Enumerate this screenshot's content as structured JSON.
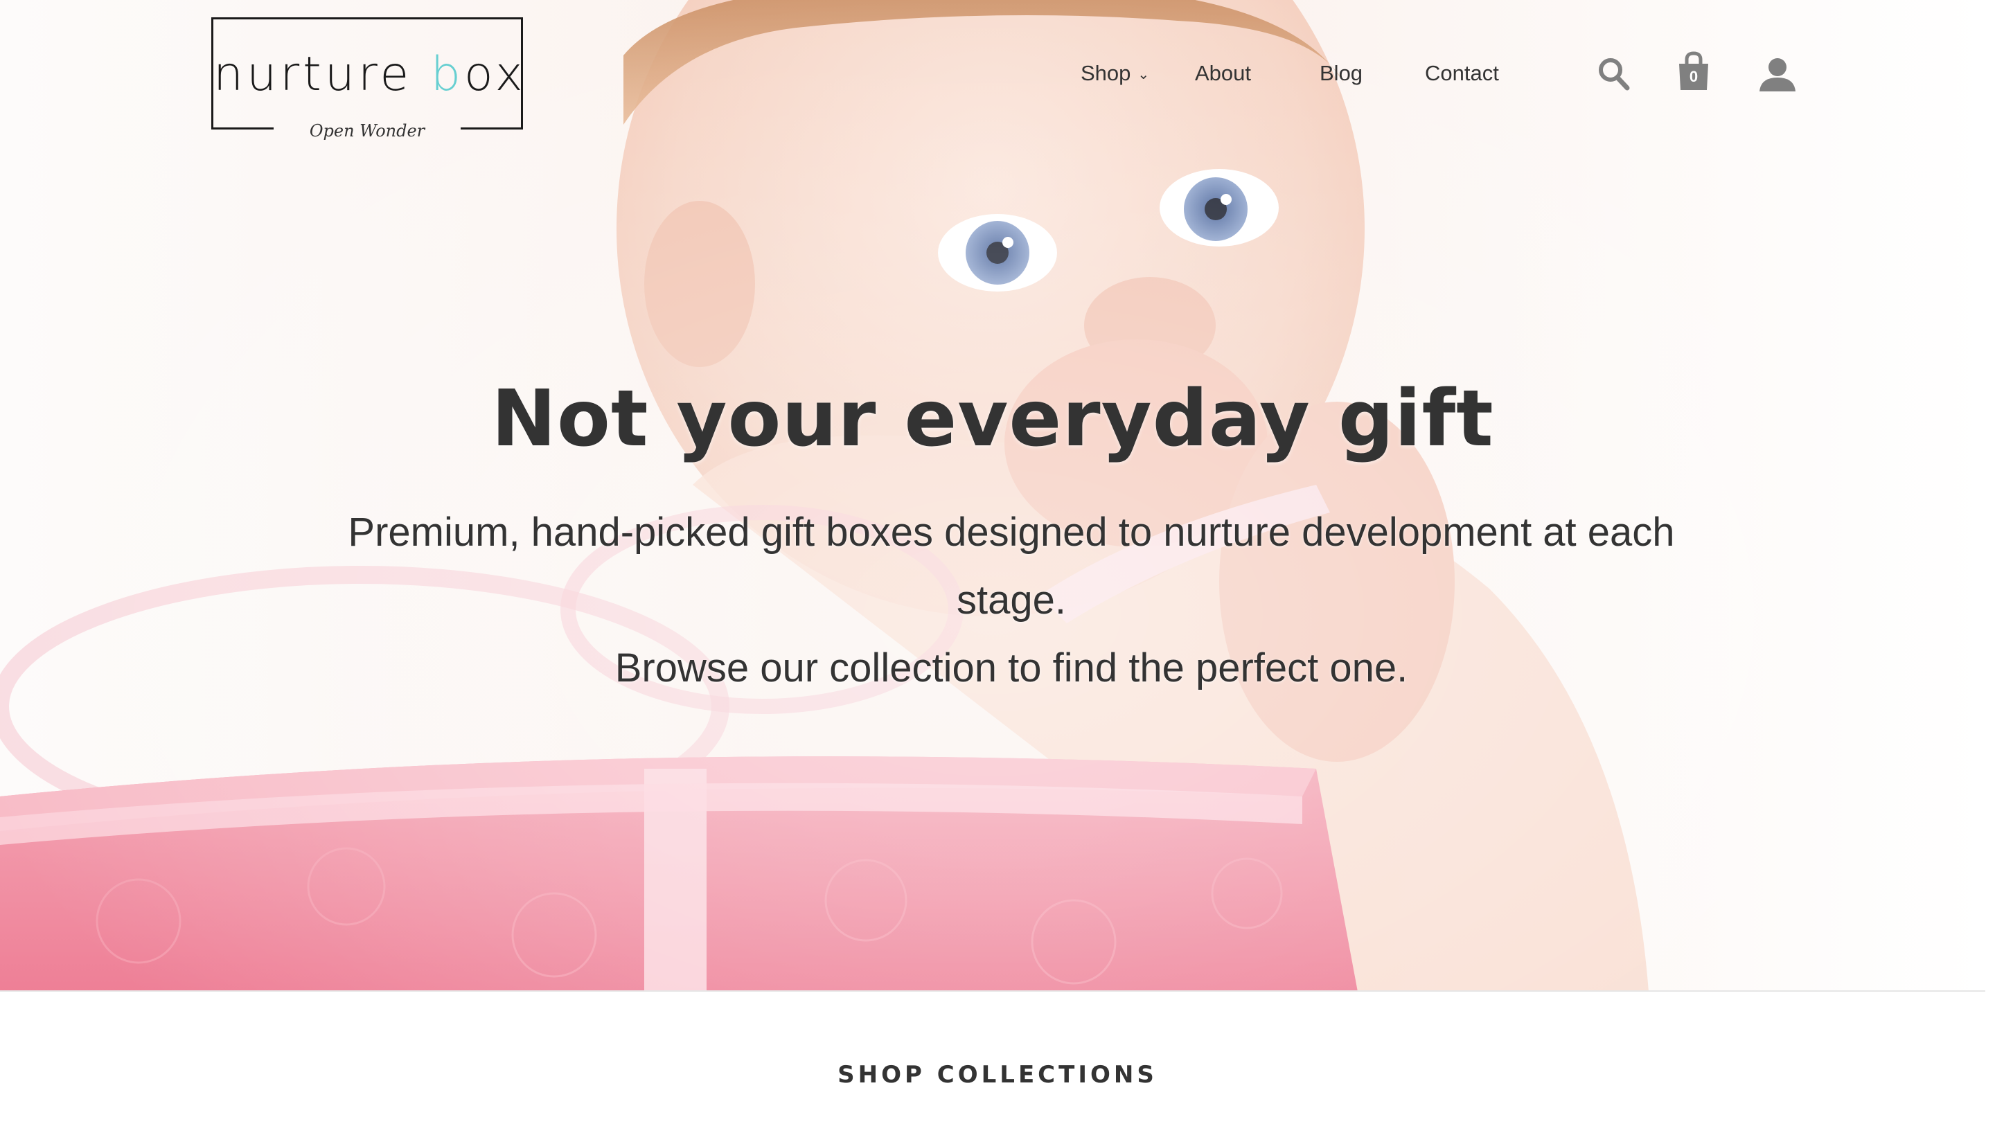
{
  "brand": {
    "wordmark_part1": "nurture ",
    "wordmark_accent": "b",
    "wordmark_part2": "ox",
    "tagline": "Open Wonder",
    "accent_color": "#67cfd1"
  },
  "nav": {
    "items": [
      {
        "label": "Shop",
        "has_dropdown": true,
        "icon": "chevron-down-icon"
      },
      {
        "label": "About"
      },
      {
        "label": "Blog"
      },
      {
        "label": "Contact"
      }
    ],
    "caret": "⌄"
  },
  "header_icons": {
    "search": "search-icon",
    "cart": "shopping-bag-icon",
    "cart_count": "0",
    "account": "user-icon"
  },
  "hero": {
    "title": "Not your everyday gift",
    "subtitle_line1": "Premium, hand-picked gift boxes designed to nurture development at each stage.",
    "subtitle_line2": "Browse our collection to find the perfect one.",
    "image": "baby-with-pink-gift-box"
  },
  "sections": {
    "collections_title": "SHOP COLLECTIONS"
  },
  "colors": {
    "text": "#333333",
    "icon": "#808080",
    "gift_pink": "#f08aa0"
  }
}
